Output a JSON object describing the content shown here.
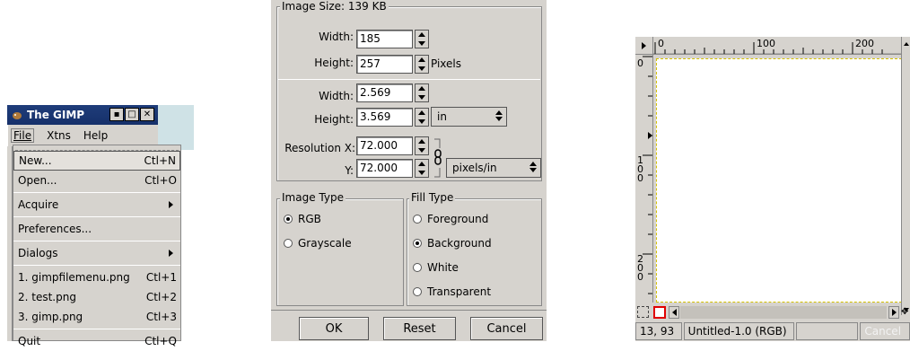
{
  "gimp_menu": {
    "window_title": "The GIMP",
    "menubar": [
      "File",
      "Xtns",
      "Help"
    ],
    "items": [
      {
        "label": "New...",
        "shortcut": "Ctl+N"
      },
      {
        "label": "Open...",
        "shortcut": "Ctl+O"
      },
      {
        "label": "Acquire",
        "shortcut": ""
      },
      {
        "label": "Preferences...",
        "shortcut": ""
      },
      {
        "label": "Dialogs",
        "shortcut": ""
      },
      {
        "label": "1. gimpfilemenu.png",
        "shortcut": "Ctl+1"
      },
      {
        "label": "2. test.png",
        "shortcut": "Ctl+2"
      },
      {
        "label": "3. gimp.png",
        "shortcut": "Ctl+3"
      },
      {
        "label": "Quit",
        "shortcut": "Ctl+Q"
      }
    ]
  },
  "new_image_dialog": {
    "image_size_label": "Image Size: 139 KB",
    "width_label": "Width:",
    "height_label": "Height:",
    "pixel_width": "185",
    "pixel_height": "257",
    "pixels_unit": "Pixels",
    "print_width": "2.569",
    "print_height": "3.569",
    "print_unit": "in",
    "resolution_x_label": "Resolution X:",
    "resolution_y_label": "Y:",
    "resolution_x": "72.000",
    "resolution_y": "72.000",
    "resolution_unit": "pixels/in",
    "image_type_label": "Image Type",
    "image_type_options": [
      "RGB",
      "Grayscale"
    ],
    "fill_type_label": "Fill Type",
    "fill_type_options": [
      "Foreground",
      "Background",
      "White",
      "Transparent"
    ],
    "buttons": {
      "ok": "OK",
      "reset": "Reset",
      "cancel": "Cancel"
    }
  },
  "image_window": {
    "ruler_labels": [
      "0",
      "100",
      "200"
    ],
    "vruler_labels": [
      "0",
      "1\n0\n0",
      "2\n0\n0"
    ],
    "coords": "13, 93",
    "title_status": "Untitled-1.0 (RGB)",
    "cancel_label": "Cancel"
  }
}
